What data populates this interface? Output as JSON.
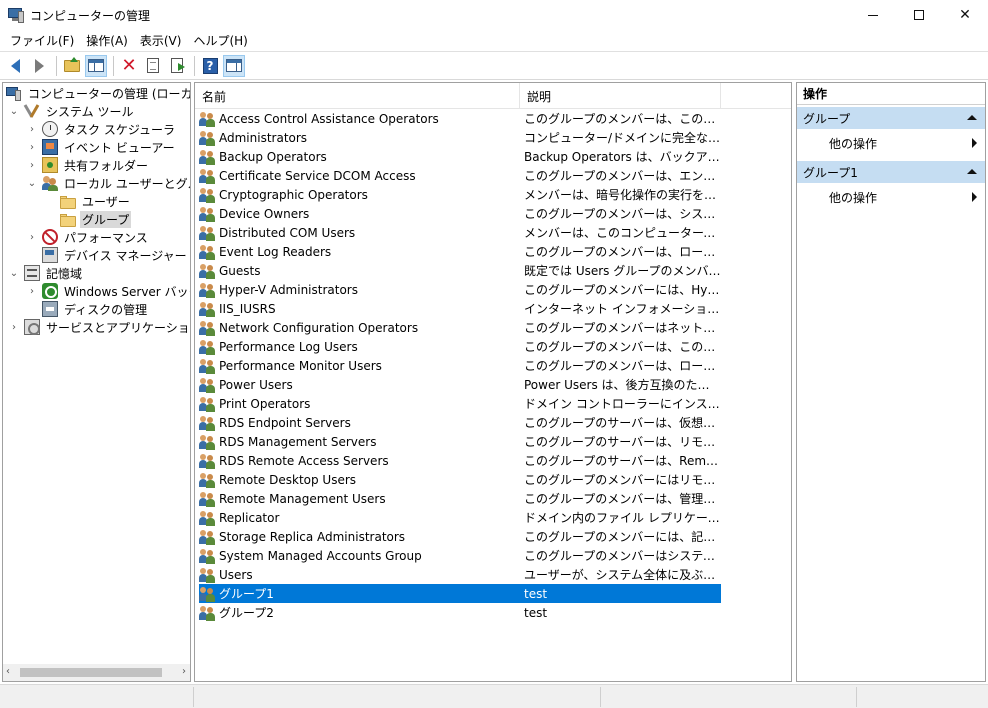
{
  "window": {
    "title": "コンピューターの管理"
  },
  "menu": [
    {
      "label": "ファイル(F)"
    },
    {
      "label": "操作(A)"
    },
    {
      "label": "表示(V)"
    },
    {
      "label": "ヘルプ(H)"
    }
  ],
  "toolbar": {
    "icons": [
      "back-arrow-icon",
      "forward-arrow-icon",
      "up-folder-icon",
      "show-hide-tree-icon",
      "delete-icon",
      "properties-icon",
      "export-list-icon",
      "help-icon",
      "show-hide-action-pane-icon"
    ]
  },
  "tree": {
    "root": "コンピューターの管理 (ローカル)",
    "system_tools": "システム ツール",
    "task_scheduler": "タスク スケジューラ",
    "event_viewer": "イベント ビューアー",
    "shared_folders": "共有フォルダー",
    "local_users_groups": "ローカル ユーザーとグループ",
    "users": "ユーザー",
    "groups": "グループ",
    "performance": "パフォーマンス",
    "device_manager": "デバイス マネージャー",
    "storage": "記憶域",
    "windows_server_backup": "Windows Server バックアップ",
    "disk_management": "ディスクの管理",
    "services_apps": "サービスとアプリケーション"
  },
  "list": {
    "col_name": "名前",
    "col_desc": "説明",
    "rows": [
      {
        "name": "Access Control Assistance Operators",
        "desc": "このグループのメンバーは、このコンピュー..."
      },
      {
        "name": "Administrators",
        "desc": "コンピューター/ドメインに完全なアクセス..."
      },
      {
        "name": "Backup Operators",
        "desc": "Backup Operators は、バックアップの..."
      },
      {
        "name": "Certificate Service DCOM Access",
        "desc": "このグループのメンバーは、エンタープライ..."
      },
      {
        "name": "Cryptographic Operators",
        "desc": "メンバーは、暗号化操作の実行を許..."
      },
      {
        "name": "Device Owners",
        "desc": "このグループのメンバーは、システム全体..."
      },
      {
        "name": "Distributed COM Users",
        "desc": "メンバーは、このコンピューターで分散 C..."
      },
      {
        "name": "Event Log Readers",
        "desc": "このグループのメンバーは、ローカル コン..."
      },
      {
        "name": "Guests",
        "desc": "既定では Users グループのメンバーと..."
      },
      {
        "name": "Hyper-V Administrators",
        "desc": "このグループのメンバーには、Hyper-V ..."
      },
      {
        "name": "IIS_IUSRS",
        "desc": "インターネット インフォメーション サービス..."
      },
      {
        "name": "Network Configuration Operators",
        "desc": "このグループのメンバーはネットワーク機..."
      },
      {
        "name": "Performance Log Users",
        "desc": "このグループのメンバーは、このコンピュー..."
      },
      {
        "name": "Performance Monitor Users",
        "desc": "このグループのメンバーは、ローカルやリ..."
      },
      {
        "name": "Power Users",
        "desc": "Power Users は、後方互換のための..."
      },
      {
        "name": "Print Operators",
        "desc": "ドメイン コントローラーにインストールされ..."
      },
      {
        "name": "RDS Endpoint Servers",
        "desc": "このグループのサーバーは、仮想マシンを..."
      },
      {
        "name": "RDS Management Servers",
        "desc": "このグループのサーバーは、リモート デス..."
      },
      {
        "name": "RDS Remote Access Servers",
        "desc": "このグループのサーバーは、RemoteAp..."
      },
      {
        "name": "Remote Desktop Users",
        "desc": "このグループのメンバーにはリモートからロ..."
      },
      {
        "name": "Remote Management Users",
        "desc": "このグループのメンバーは、管理プロトコ..."
      },
      {
        "name": "Replicator",
        "desc": "ドメイン内のファイル レプリケーションを..."
      },
      {
        "name": "Storage Replica Administrators",
        "desc": "このグループのメンバーには、記憶域レ..."
      },
      {
        "name": "System Managed Accounts Group",
        "desc": "このグループのメンバーはシステムで管..."
      },
      {
        "name": "Users",
        "desc": "ユーザーが、システム全体に及ぶ変更を..."
      },
      {
        "name": "グループ1",
        "desc": "test"
      },
      {
        "name": "グループ2",
        "desc": "test"
      }
    ],
    "selected_index": 25
  },
  "actions": {
    "title": "操作",
    "sections": [
      {
        "header": "グループ",
        "item": "他の操作"
      },
      {
        "header": "グループ1",
        "item": "他の操作"
      }
    ]
  },
  "colors": {
    "selection": "#0078d7",
    "action_header": "#c5ddf2"
  }
}
